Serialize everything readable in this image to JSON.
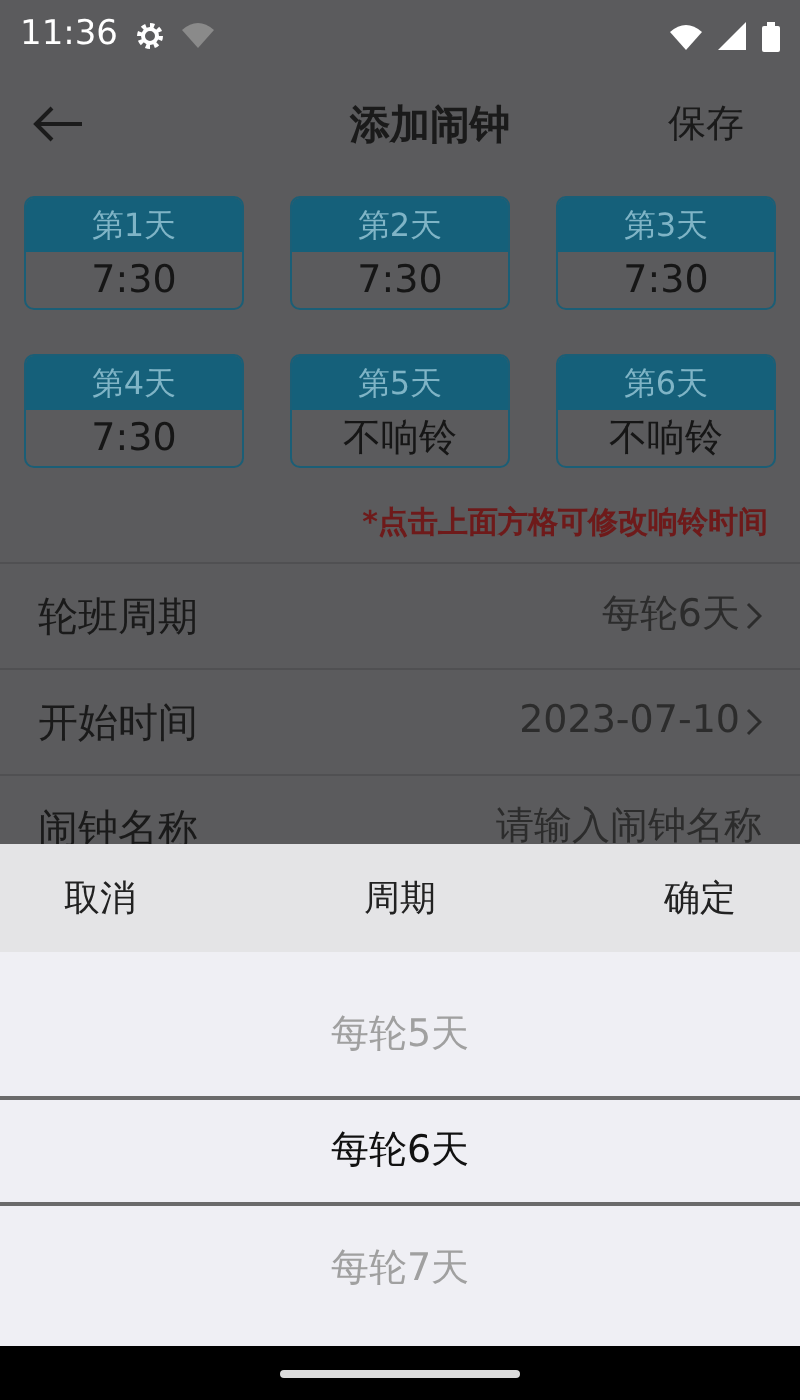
{
  "status_bar": {
    "time": "11:36"
  },
  "header": {
    "title": "添加闹钟",
    "action": "保存"
  },
  "days": [
    {
      "label": "第1天",
      "value": "7:30"
    },
    {
      "label": "第2天",
      "value": "7:30"
    },
    {
      "label": "第3天",
      "value": "7:30"
    },
    {
      "label": "第4天",
      "value": "7:30"
    },
    {
      "label": "第5天",
      "value": "不响铃"
    },
    {
      "label": "第6天",
      "value": "不响铃"
    }
  ],
  "hint": "*点击上面方格可修改响铃时间",
  "settings": [
    {
      "label": "轮班周期",
      "value": "每轮6天",
      "kind": "select"
    },
    {
      "label": "开始时间",
      "value": "2023-07-10",
      "kind": "select"
    },
    {
      "label": "闹钟名称",
      "placeholder": "请输入闹钟名称",
      "kind": "input"
    }
  ],
  "picker": {
    "cancel": "取消",
    "title": "周期",
    "confirm": "确定",
    "options": [
      {
        "label": "每轮5天",
        "selected": false
      },
      {
        "label": "每轮6天",
        "selected": true
      },
      {
        "label": "每轮7天",
        "selected": false
      }
    ]
  }
}
